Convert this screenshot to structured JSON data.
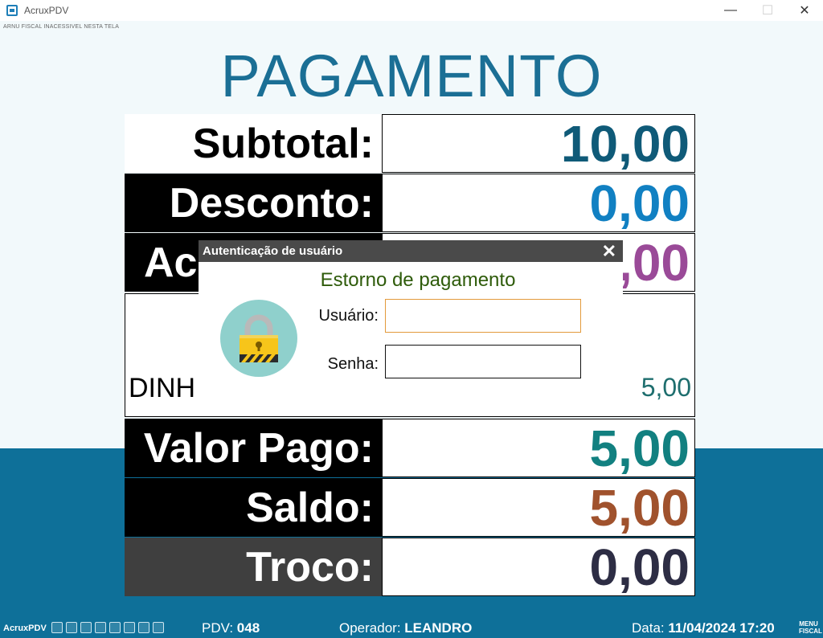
{
  "window": {
    "title": "AcruxPDV",
    "tiny_text": "ARNU FISCAL INACESSIVEL NESTA TELA"
  },
  "page_title": "PAGAMENTO",
  "rows": {
    "subtotal": {
      "label": "Subtotal:",
      "value": "10,00",
      "color": "#0f5a78"
    },
    "desconto": {
      "label": "Desconto:",
      "value": "0,00",
      "color": "#1180c2"
    },
    "acrescimo": {
      "label": "Ac",
      "value": ",00",
      "color": "#9a4a98"
    },
    "valor_pago": {
      "label": "Valor Pago:",
      "value": "5,00",
      "color": "#128080"
    },
    "saldo": {
      "label": "Saldo:",
      "value": "5,00",
      "color": "#a0522d"
    },
    "troco": {
      "label": "Troco:",
      "value": "0,00",
      "color": "#2d2d44"
    }
  },
  "payment": {
    "method": "DINH",
    "amount": "5,00"
  },
  "modal": {
    "title": "Autenticação de usuário",
    "subtitle": "Estorno de pagamento",
    "user_label": "Usuário:",
    "password_label": "Senha:",
    "icon": "lock-icon"
  },
  "status": {
    "app": "AcruxPDV",
    "pdv_label": "PDV:",
    "pdv_value": "048",
    "operador_label": "Operador:",
    "operador_value": "LEANDRO",
    "data_label": "Data:",
    "data_value": "11/04/2024 17:20",
    "menu_line1": "MENU",
    "menu_line2": "FISCAL"
  }
}
